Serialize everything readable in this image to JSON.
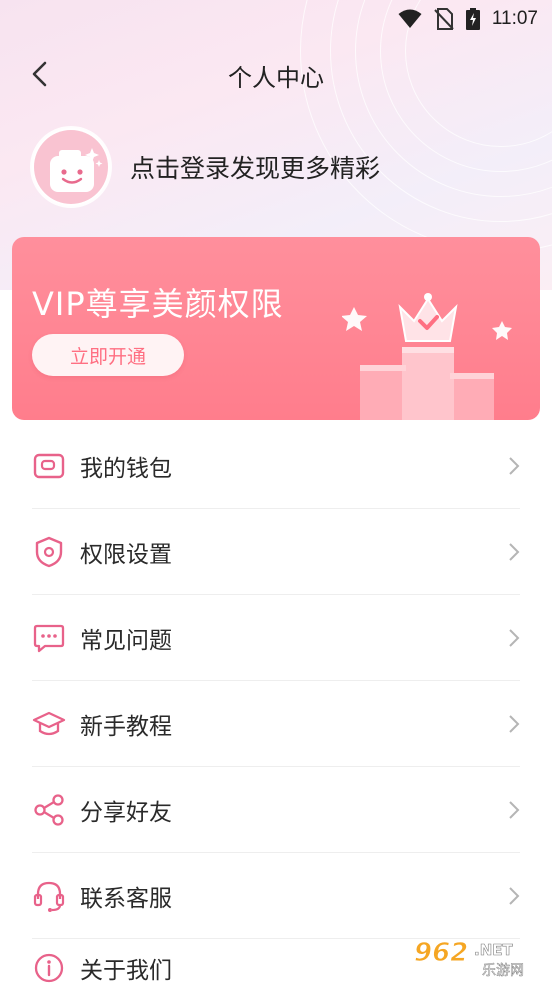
{
  "status_bar": {
    "time": "11:07"
  },
  "header": {
    "title": "个人中心"
  },
  "profile": {
    "login_prompt": "点击登录发现更多精彩"
  },
  "vip": {
    "title": "VIP尊享美颜权限",
    "button_label": "立即开通"
  },
  "menu": {
    "items": [
      {
        "label": "我的钱包",
        "icon": "wallet-icon"
      },
      {
        "label": "权限设置",
        "icon": "shield-icon"
      },
      {
        "label": "常见问题",
        "icon": "chat-bubble-icon"
      },
      {
        "label": "新手教程",
        "icon": "graduation-cap-icon"
      },
      {
        "label": "分享好友",
        "icon": "share-icon"
      },
      {
        "label": "联系客服",
        "icon": "headset-icon"
      },
      {
        "label": "关于我们",
        "icon": "info-icon"
      }
    ]
  },
  "watermark": {
    "text": "962.NET",
    "subtext": "乐游网"
  },
  "colors": {
    "accent": "#e8628a",
    "vip_card": "#ff8595",
    "vip_button_text": "#ff6f82"
  }
}
